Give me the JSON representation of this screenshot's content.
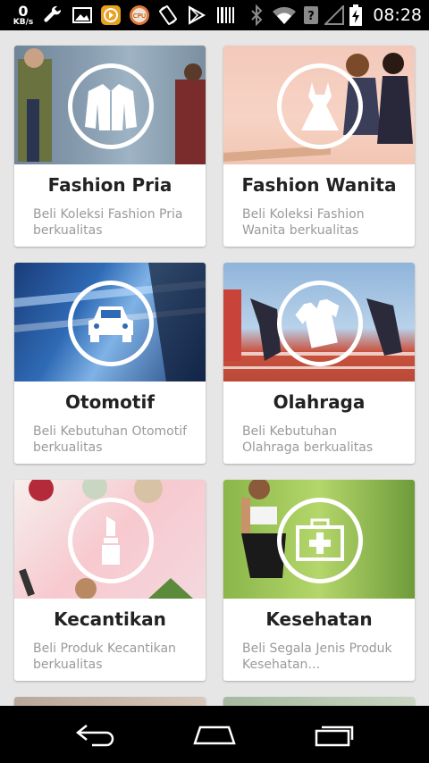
{
  "status_bar": {
    "net_speed_value": "0",
    "net_speed_unit": "KB/s",
    "cpu_label": "CPU",
    "time": "08:28",
    "icons": [
      "wrench-icon",
      "image-icon",
      "app-icon",
      "cpu-icon",
      "rotate-icon",
      "play-store-icon",
      "barcode-icon",
      "bluetooth-icon",
      "wifi-icon",
      "signal-icon",
      "battery-icon"
    ]
  },
  "categories": [
    {
      "title": "Fashion Pria",
      "desc": "Beli Koleksi Fashion Pria berkualitas",
      "icon": "jacket-icon"
    },
    {
      "title": "Fashion Wanita",
      "desc": "Beli Koleksi Fashion Wanita berkualitas",
      "icon": "dress-icon"
    },
    {
      "title": "Otomotif",
      "desc": "Beli Kebutuhan Otomotif berkualitas",
      "icon": "car-icon"
    },
    {
      "title": "Olahraga",
      "desc": "Beli Kebutuhan Olahraga berkualitas",
      "icon": "jersey-icon"
    },
    {
      "title": "Kecantikan",
      "desc": "Beli Produk Kecantikan berkualitas",
      "icon": "lipstick-icon"
    },
    {
      "title": "Kesehatan",
      "desc": "Beli Segala Jenis Produk Kesehatan…",
      "icon": "first-aid-icon"
    }
  ],
  "nav": {
    "icons": [
      "back-icon",
      "home-icon",
      "recent-apps-icon"
    ]
  },
  "colors": {
    "status_bar": "#000000",
    "background": "#e6e6e6",
    "card": "#ffffff",
    "title": "#222222",
    "desc": "#9a9a9a"
  }
}
